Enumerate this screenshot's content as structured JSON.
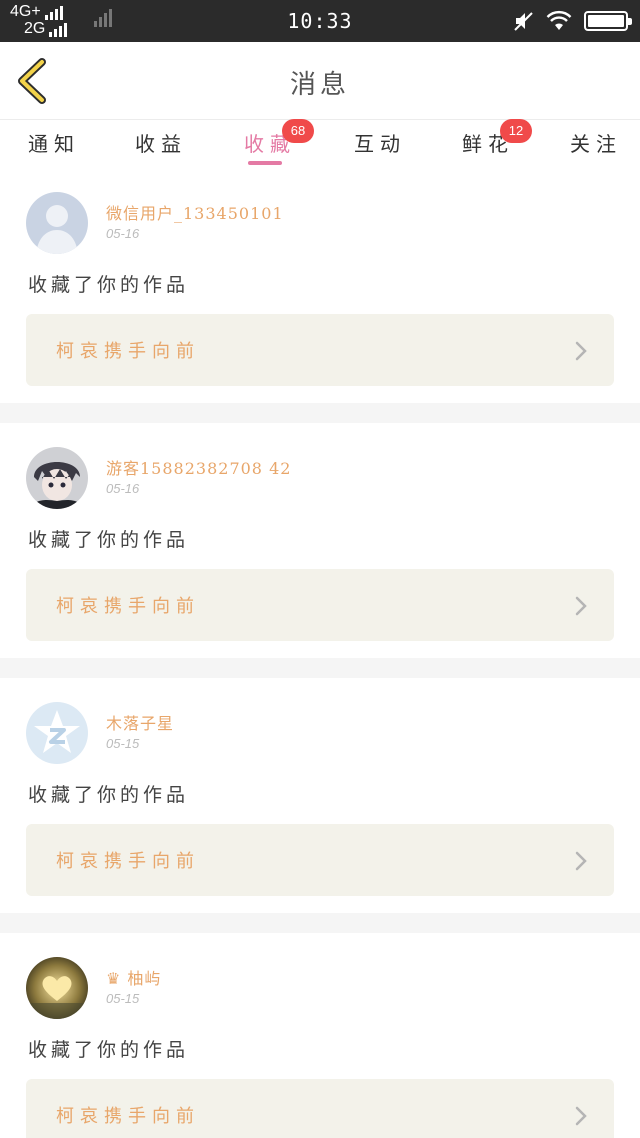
{
  "status_bar": {
    "network_top": "4G+",
    "network_bottom": "2G",
    "time": "10:33"
  },
  "header": {
    "title": "消息"
  },
  "tabs": [
    {
      "label": "通知"
    },
    {
      "label": "收益"
    },
    {
      "label": "收藏",
      "badge": "68",
      "active": true
    },
    {
      "label": "互动"
    },
    {
      "label": "鲜花",
      "badge": "12"
    },
    {
      "label": "关注"
    }
  ],
  "feed": [
    {
      "username": "微信用户_133450101",
      "date": "05-16",
      "action": "收藏了你的作品",
      "work_title": "柯哀携手向前",
      "avatar": "default-person-avatar"
    },
    {
      "username": "游客15882382708 42",
      "date": "05-16",
      "action": "收藏了你的作品",
      "work_title": "柯哀携手向前",
      "avatar": "anime-boy-avatar"
    },
    {
      "username": "木落子星",
      "date": "05-15",
      "action": "收藏了你的作品",
      "work_title": "柯哀携手向前",
      "avatar": "qq-star-avatar"
    },
    {
      "username": "♛ 柚屿",
      "date": "05-15",
      "action": "收藏了你的作品",
      "work_title": "柯哀携手向前",
      "avatar": "heart-photo-avatar"
    }
  ],
  "colors": {
    "accent_pink": "#e47aa4",
    "badge_red": "#f04a4a",
    "username_orange": "#e8a66a",
    "work_card_bg": "#f3f2ea"
  }
}
